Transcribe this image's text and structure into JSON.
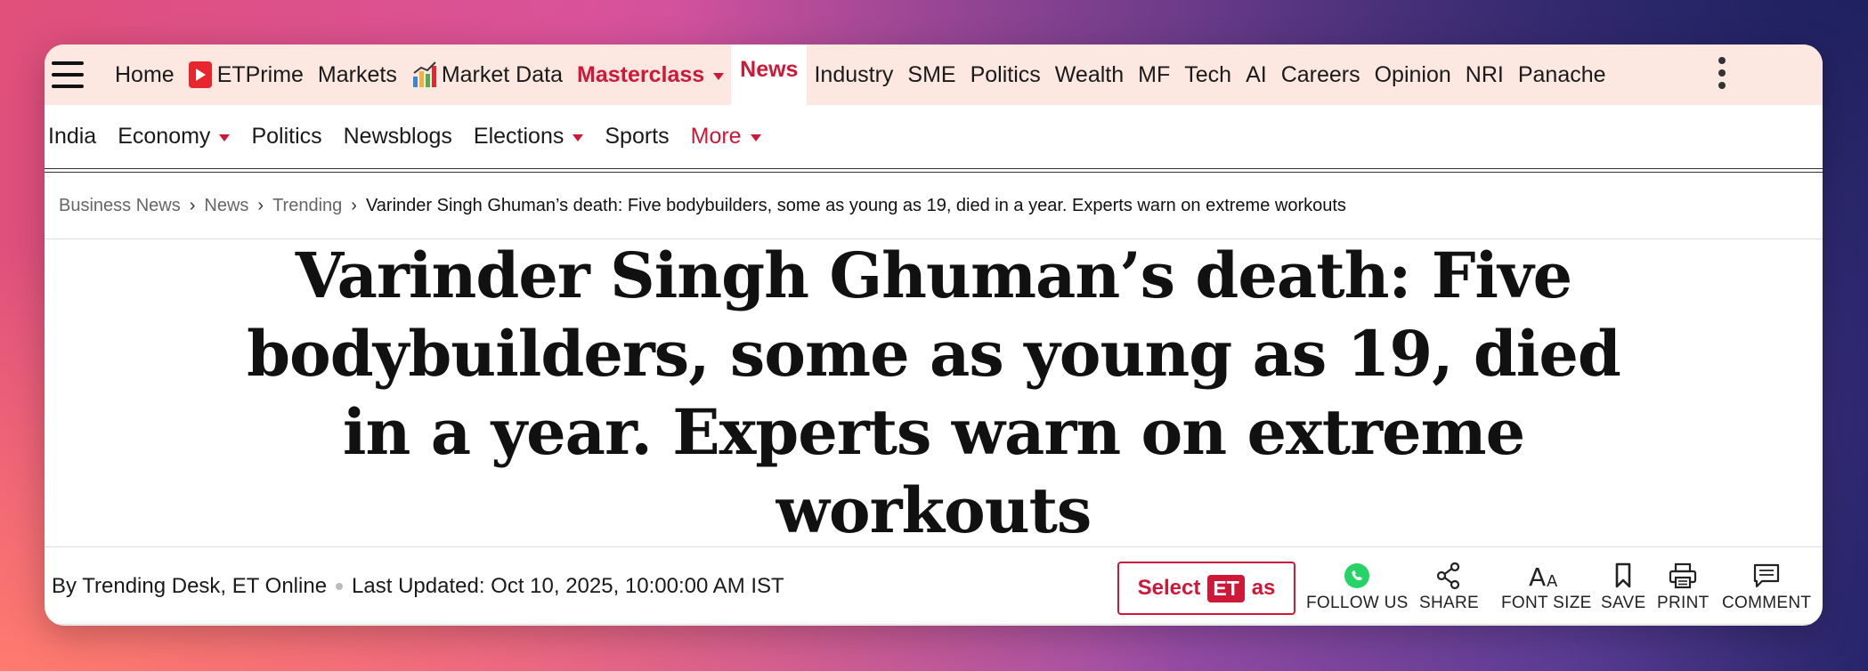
{
  "topnav": {
    "items": [
      {
        "label": "Home"
      },
      {
        "label": "ETPrime"
      },
      {
        "label": "Markets"
      },
      {
        "label": "Market Data"
      },
      {
        "label": "Masterclass"
      },
      {
        "label": "News"
      },
      {
        "label": "Industry"
      },
      {
        "label": "SME"
      },
      {
        "label": "Politics"
      },
      {
        "label": "Wealth"
      },
      {
        "label": "MF"
      },
      {
        "label": "Tech"
      },
      {
        "label": "AI"
      },
      {
        "label": "Careers"
      },
      {
        "label": "Opinion"
      },
      {
        "label": "NRI"
      },
      {
        "label": "Panache"
      }
    ],
    "active": "News",
    "accent": "#cf1837",
    "background": "#fde7e1"
  },
  "subnav": {
    "items": [
      {
        "label": "India"
      },
      {
        "label": "Economy"
      },
      {
        "label": "Politics"
      },
      {
        "label": "Newsblogs"
      },
      {
        "label": "Elections"
      },
      {
        "label": "Sports"
      },
      {
        "label": "More"
      }
    ]
  },
  "breadcrumb": {
    "items": [
      "Business News",
      "News",
      "Trending"
    ],
    "separator": "›",
    "current": "Varinder Singh Ghuman’s death: Five bodybuilders, some as young as 19, died in a year. Experts warn on extreme workouts"
  },
  "article": {
    "headline": "Varinder Singh Ghuman’s death: Five bodybuilders, some as young as 19, died in a year. Experts warn on extreme workouts",
    "byline": "By Trending Desk, ET Online",
    "updated": "Last Updated: Oct 10, 2025, 10:00:00 AM IST"
  },
  "actions": {
    "select_prefix": "Select",
    "select_badge": "ET",
    "select_suffix": "as",
    "follow": "FOLLOW US",
    "share": "SHARE",
    "font_size": "FONT SIZE",
    "save": "SAVE",
    "print": "PRINT",
    "comment": "COMMENT"
  }
}
